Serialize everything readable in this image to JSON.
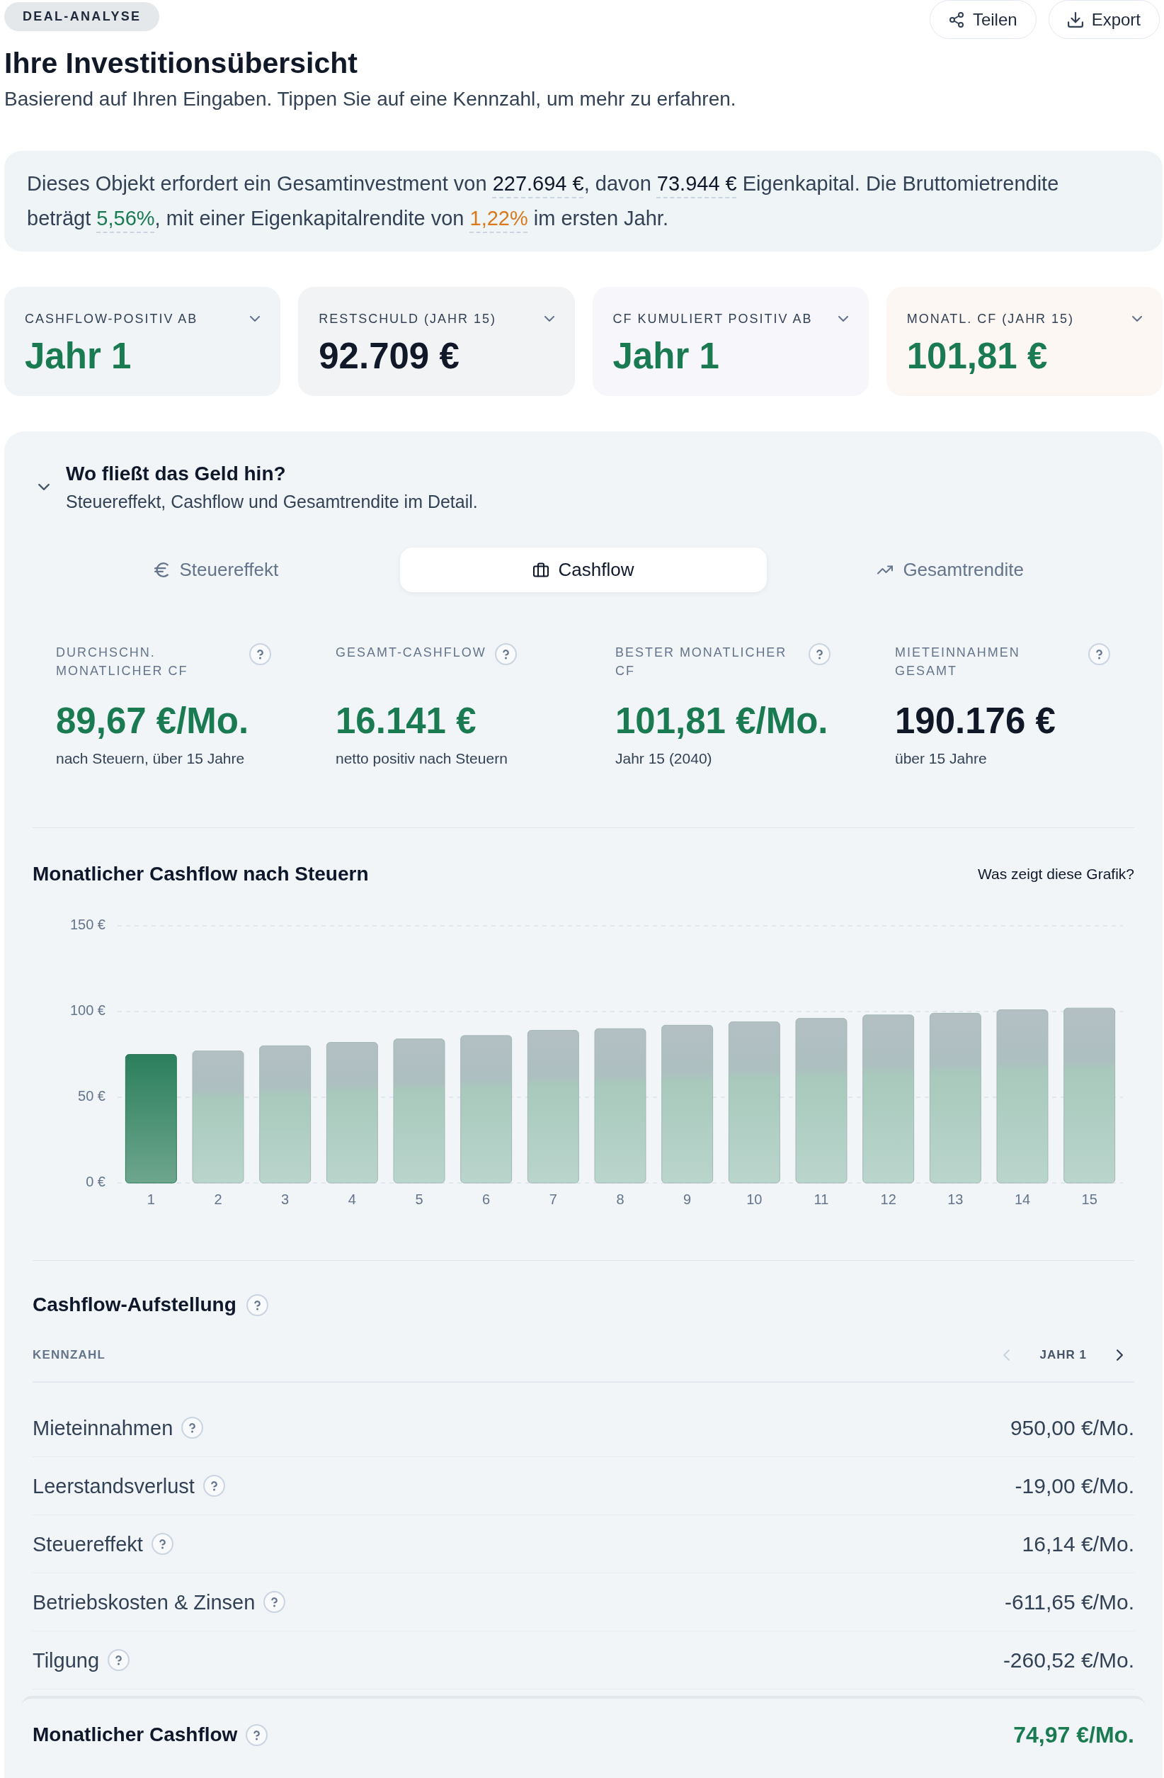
{
  "header": {
    "badge": "DEAL-ANALYSE",
    "actions": [
      {
        "label": "Teilen"
      },
      {
        "label": "Export"
      }
    ]
  },
  "title": "Ihre Investitionsübersicht",
  "subtitle": "Basierend auf Ihren Eingaben. Tippen Sie auf eine Kennzahl, um mehr zu erfahren.",
  "summary": {
    "segments": [
      {
        "text": "Dieses Objekt erfordert ein Gesamtinvestment von "
      },
      {
        "text": "227.694 €",
        "color": "#0f172a"
      },
      {
        "text": ", davon "
      },
      {
        "text": "73.944 €",
        "color": "#0f172a"
      },
      {
        "text": " Eigenkapital. Die Bruttomietrendite beträgt "
      },
      {
        "text": "5,56%",
        "color": "#1a7b53"
      },
      {
        "text": ", mit einer Eigenkapitalrendite von "
      },
      {
        "text": "1,22%",
        "color": "#d9791c"
      },
      {
        "text": " im ersten Jahr."
      }
    ]
  },
  "kpi_cards": [
    {
      "label": "CASHFLOW-POSITIV AB",
      "value": "Jahr 1",
      "positive": true,
      "expanded": false,
      "color": "#f0f4f6"
    },
    {
      "label": "RESTSCHULD (JAHR 15)",
      "value": "92.709 €",
      "positive": false,
      "expanded": false,
      "color": "#f2f3f4"
    },
    {
      "label": "CF KUMULIERT POSITIV AB",
      "value": "Jahr 1",
      "positive": true,
      "expanded": false,
      "color": "#f6f6fb"
    },
    {
      "label": "MONATL. CF (JAHR 15)",
      "value": "101,81 €",
      "positive": true,
      "expanded": false,
      "color": "#fcf7f3"
    }
  ],
  "details": {
    "expanded": true,
    "title": "Wo fließt das Geld hin?",
    "subtitle": "Steuereffekt, Cashflow und Gesamtrendite im Detail.",
    "tabs": [
      {
        "label": "Steuereffekt",
        "selected": false
      },
      {
        "label": "Cashflow",
        "selected": true
      },
      {
        "label": "Gesamtrendite",
        "selected": false
      }
    ],
    "metrics": [
      {
        "label": "DURCHSCHN. MONATLICHER CF",
        "value": "89,67 €/Mo.",
        "note": "nach Steuern, über 15 Jahre",
        "positive": true
      },
      {
        "label": "GESAMT-CASHFLOW",
        "value": "16.141 €",
        "note": "netto positiv nach Steuern",
        "positive": true
      },
      {
        "label": "BESTER MONATLICHER CF",
        "value": "101,81 €/Mo.",
        "note": "Jahr 15 (2040)",
        "positive": true
      },
      {
        "label": "MIETEINNAHMEN GESAMT",
        "value": "190.176 €",
        "note": "über 15 Jahre",
        "positive": false
      }
    ],
    "chart": {
      "help_link": "Was zeigt diese Grafik?",
      "bars": [
        {
          "selected": true
        },
        {
          "selected": false
        },
        {
          "selected": false
        },
        {
          "selected": false
        },
        {
          "selected": false
        },
        {
          "selected": false
        },
        {
          "selected": false
        },
        {
          "selected": false
        },
        {
          "selected": false
        },
        {
          "selected": false
        },
        {
          "selected": false
        },
        {
          "selected": false
        },
        {
          "selected": false
        },
        {
          "selected": false
        },
        {
          "selected": false
        }
      ],
      "chart_data": {
        "type": "bar",
        "title": "Monatlicher Cashflow nach Steuern",
        "categories": [
          "1",
          "2",
          "3",
          "4",
          "5",
          "6",
          "7",
          "8",
          "9",
          "10",
          "11",
          "12",
          "13",
          "14",
          "15"
        ],
        "values": [
          75,
          77,
          80,
          82,
          84,
          86,
          89,
          90,
          92,
          94,
          96,
          98,
          99,
          101,
          102
        ],
        "ylim": [
          0,
          150
        ],
        "yticks": [
          {
            "value": 0,
            "label": "0 €"
          },
          {
            "value": 50,
            "label": "50 €"
          },
          {
            "value": 100,
            "label": "100 €"
          },
          {
            "value": 150,
            "label": "150 €"
          }
        ]
      }
    },
    "breakdown": {
      "title": "Cashflow-Aufstellung",
      "column_1": "KENNZAHL",
      "year_nav": {
        "label": "JAHR 1",
        "prev_disabled": true,
        "next_disabled": false
      },
      "rows": [
        {
          "label": "Mieteinnahmen",
          "value": "950,00 €/Mo."
        },
        {
          "label": "Leerstandsverlust",
          "value": "-19,00 €/Mo."
        },
        {
          "label": "Steuereffekt",
          "value": "16,14 €/Mo."
        },
        {
          "label": "Betriebskosten & Zinsen",
          "value": "-611,65 €/Mo."
        },
        {
          "label": "Tilgung",
          "value": "-260,52 €/Mo."
        }
      ],
      "total": {
        "label": "Monatlicher Cashflow",
        "value": "74,97 €/Mo.",
        "positive": true
      }
    }
  }
}
